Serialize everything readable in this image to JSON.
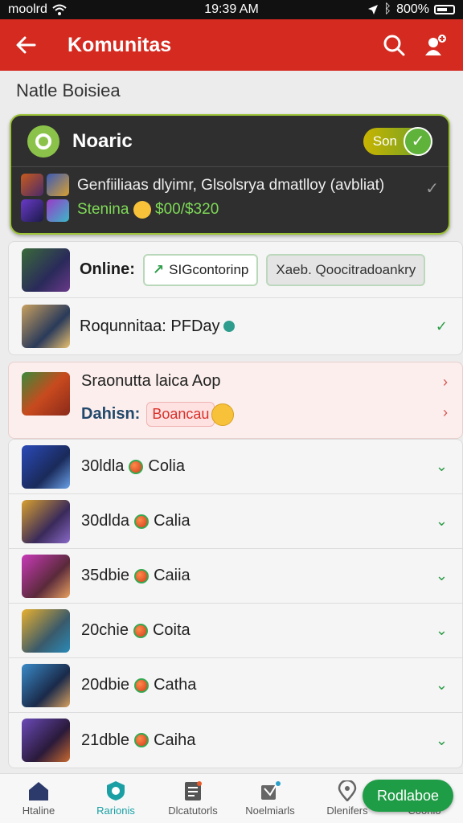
{
  "status_bar": {
    "carrier": "moolrd",
    "time": "19:39 AM",
    "battery": "800%"
  },
  "appbar": {
    "title": "Komunitas"
  },
  "section_title": "Natle Boisiea",
  "featured": {
    "name": "Noaric",
    "toggle_label": "Son",
    "description": "Genfiiliaas dlyimr, Glsolsrya dmatlloy (avbliat)",
    "stat_label": "Stenina",
    "stat_value": "$00/$320"
  },
  "group1": {
    "online_label": "Online:",
    "button1": "SIGcontorinp",
    "button2": "Xaeb. Qoocitradoankry",
    "row2_label": "Roqunnitaa: PFDay"
  },
  "highlight": {
    "line1": "Sraonutta laica Aop",
    "line2_label": "Dahisn:",
    "tag": "Boancau"
  },
  "list": [
    {
      "count": "30ldla",
      "label": "Colia"
    },
    {
      "count": "30dlda",
      "label": "Calia"
    },
    {
      "count": "35dbie",
      "label": "Caiia"
    },
    {
      "count": "20chie",
      "label": "Coita"
    },
    {
      "count": "20dbie",
      "label": "Catha"
    },
    {
      "count": "21dble",
      "label": "Caiha"
    }
  ],
  "nav": [
    {
      "label": "Htaline",
      "icon": "home-icon"
    },
    {
      "label": "Rarionis",
      "icon": "shield-icon"
    },
    {
      "label": "Dlcatutorls",
      "icon": "document-icon"
    },
    {
      "label": "Noelmiarls",
      "icon": "cards-icon"
    },
    {
      "label": "Dlenifers",
      "icon": "location-icon"
    },
    {
      "label": "Coonlo",
      "icon": "profile-icon"
    }
  ],
  "fab_label": "Rodlaboe"
}
